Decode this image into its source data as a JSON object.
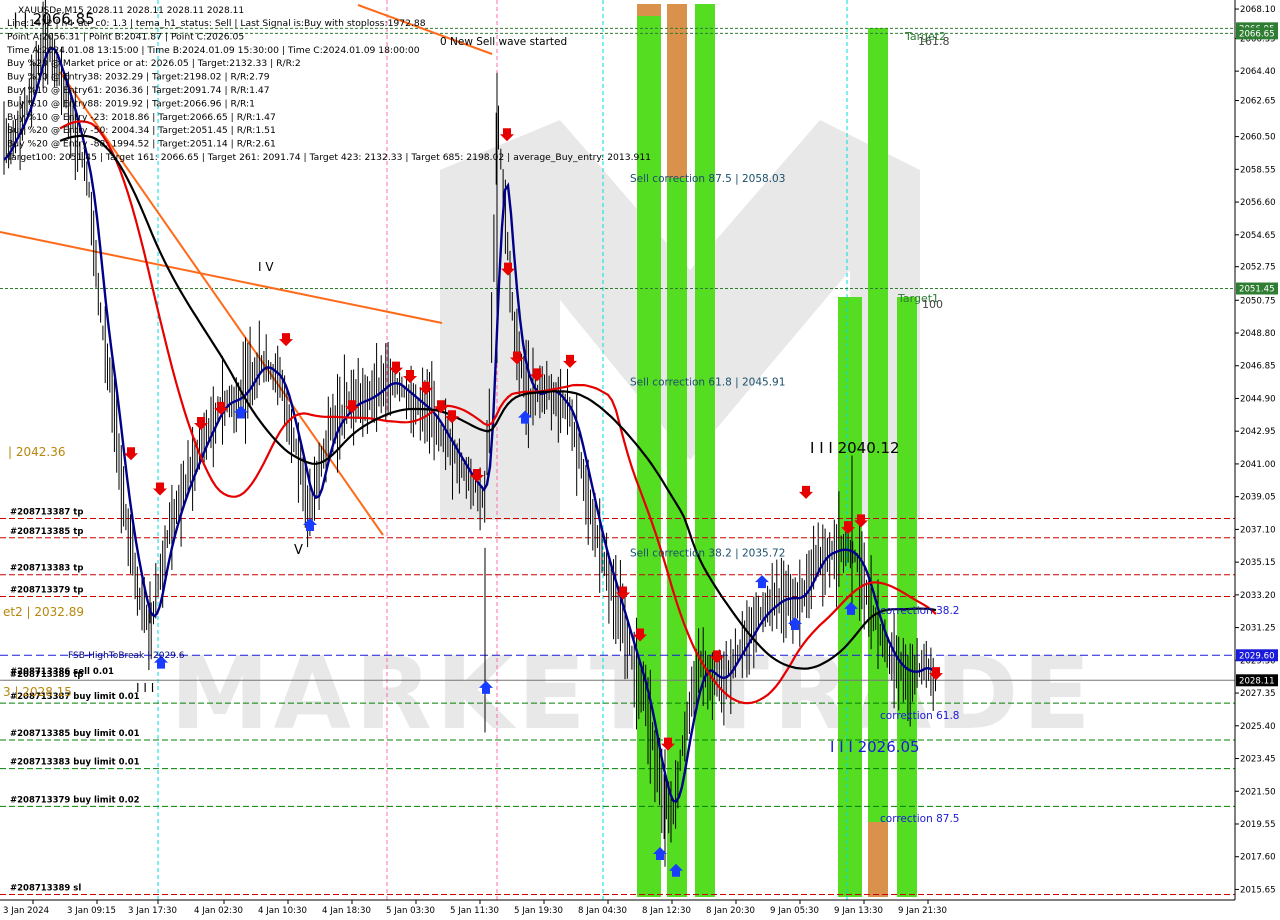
{
  "chart_data": {
    "type": "candlestick",
    "symbol_line": "XAUUSDe,M15  2028.11 2028.11 2028.11 2028.11",
    "info_lines": [
      "Line:1472 | h4_atr_c0: 1.3 | tema_h1_status: Sell | Last Signal is:Buy with stoploss:1972.88",
      "Point A:2056.31 | Point B:2041.87 | Point C:2026.05",
      "Time A:2024.01.08 13:15:00 | Time B:2024.01.09 15:30:00 | Time C:2024.01.09 18:00:00",
      "Buy %20 @ Market price or at: 2026.05 | Target:2132.33 | R/R:2",
      "Buy %10 @ Entry38: 2032.29 | Target:2198.02 | R/R:2.79",
      "Buy %10 @ Entry61: 2036.36 | Target:2091.74 | R/R:1.47",
      "Buy %10 @ Entry88: 2019.92 | Target:2066.96 | R/R:1",
      "Buy %10 @ Entry -23: 2018.86 | Target:2066.65 | R/R:1.47",
      "Buy %20 @ Entry -50: 2004.34 | Target:2051.45 | R/R:1.51",
      "Buy %20 @ Entry -88: 1994.52 | Target:2051.14 | R/R:2.61",
      "Target100: 2051.45 | Target 161: 2066.65 | Target 261: 2091.74 | Target 423: 2132.33 | Target 685: 2198.02 | average_Buy_entry: 2013.911"
    ],
    "y_ticks": [
      "2068.10",
      "2066.35",
      "2064.40",
      "2062.65",
      "2060.50",
      "2058.55",
      "2056.60",
      "2054.65",
      "2052.75",
      "2050.75",
      "2048.80",
      "2046.85",
      "2044.90",
      "2042.95",
      "2041.00",
      "2039.05",
      "2037.10",
      "2035.15",
      "2033.20",
      "2031.25",
      "2029.30",
      "2027.35",
      "2025.40",
      "2023.45",
      "2021.50",
      "2019.55",
      "2017.60",
      "2015.65"
    ],
    "x_ticks": [
      "3 Jan 2024",
      "3 Jan 09:15",
      "3 Jan 17:30",
      "4 Jan 02:30",
      "4 Jan 10:30",
      "4 Jan 18:30",
      "5 Jan 03:30",
      "5 Jan 11:30",
      "5 Jan 19:30",
      "8 Jan 04:30",
      "8 Jan 12:30",
      "8 Jan 20:30",
      "9 Jan 05:30",
      "9 Jan 13:30",
      "9 Jan 21:30"
    ],
    "ylim": [
      2015.2,
      2068.4
    ],
    "price_tags": [
      {
        "text": "2066.95",
        "price": 2066.95,
        "color": "#2e7d32"
      },
      {
        "text": "2066.65",
        "price": 2066.65,
        "color": "#2e7d32"
      },
      {
        "text": "2051.45",
        "price": 2051.45,
        "color": "#2e7d32"
      },
      {
        "text": "2029.60",
        "price": 2029.6,
        "color": "#1a1adb"
      },
      {
        "text": "2028.11",
        "price": 2028.11,
        "color": "#000000"
      }
    ],
    "order_lines": [
      {
        "label": "#208713387 tp",
        "price": 2037.75,
        "color": "#cc0000"
      },
      {
        "label": "#208713385 tp",
        "price": 2036.6,
        "color": "#cc0000"
      },
      {
        "label": "#208713383 tp",
        "price": 2034.4,
        "color": "#cc0000"
      },
      {
        "label": "#208713379 tp",
        "price": 2033.1,
        "color": "#cc0000"
      },
      {
        "label": "#208713389 sl",
        "price": 2015.35,
        "color": "#cc0000"
      },
      {
        "label": "#208713387 buy limit 0.01",
        "price": 2026.75,
        "color": "#008000"
      },
      {
        "label": "#208713385 buy limit 0.01",
        "price": 2024.55,
        "color": "#008000"
      },
      {
        "label": "#208713383 buy limit 0.01",
        "price": 2022.85,
        "color": "#008000"
      },
      {
        "label": "#208713379 buy limit 0.02",
        "price": 2020.6,
        "color": "#008000"
      }
    ],
    "stacked_labels": [
      "#208713386 sell 0.01",
      "#208713389 tp"
    ],
    "level_labels": [
      {
        "text": "| 2042.36",
        "color": "#b8860b"
      },
      {
        "text": "et2 | 2032.89",
        "color": "#b8860b"
      },
      {
        "text": "3 | 2028.15",
        "color": "#b8860b"
      },
      {
        "text": "FSB-HighToBreak | 2029.6",
        "color": "#000080"
      },
      {
        "text": "0 New Sell wave started",
        "color": "#000000"
      },
      {
        "text": "| | 2066.85",
        "color": "#000000"
      },
      {
        "text": "I I I 2040.12",
        "color": "#000000"
      },
      {
        "text": "I I I 2026.05",
        "color": "#1a1adb"
      },
      {
        "text": "Target2",
        "color": "#2e7d32"
      },
      {
        "text": "161.8",
        "color": "#444444"
      },
      {
        "text": "Target1",
        "color": "#2e7d32"
      },
      {
        "text": "100",
        "color": "#444444"
      },
      {
        "text": "I V",
        "color": "#000000"
      },
      {
        "text": "V",
        "color": "#000000"
      },
      {
        "text": "I I I",
        "color": "#000000"
      }
    ],
    "correction_labels": [
      {
        "text": "Sell correction 87.5 | 2058.03",
        "price": 2058.03
      },
      {
        "text": "Sell correction 61.8 | 2045.91",
        "price": 2045.91
      },
      {
        "text": "Sell correction 38.2 | 2035.72",
        "price": 2035.72
      },
      {
        "text": "correction 38.2",
        "price": 2032.29
      },
      {
        "text": "correction 61.8",
        "price": 2026.05
      },
      {
        "text": "correction 87.5",
        "price": 2019.92
      }
    ],
    "watermark": "MARKET TRADE",
    "colors": {
      "candle": "#000000",
      "ma_fast": "#00008b",
      "ma_slow": "#000000",
      "ma_red": "#e60000",
      "trend": "#ff6a1a",
      "green_zone": "#55dd22",
      "orange_zone": "#d9914c",
      "cyan_vline": "#00dede",
      "pink_vline": "#ff69b4",
      "sell_arrow": "#e60000",
      "buy_arrow": "#1a3cff"
    }
  }
}
